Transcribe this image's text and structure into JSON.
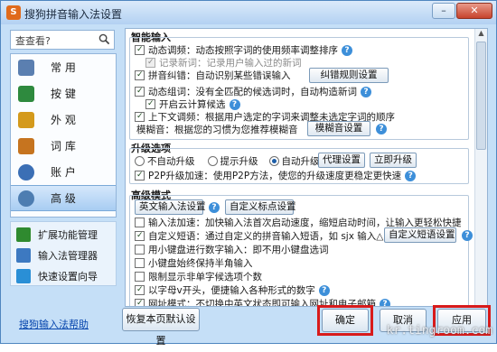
{
  "window": {
    "title": "搜狗拼音输入法设置"
  },
  "search": {
    "placeholder": "查查看?"
  },
  "nav": [
    {
      "label": "常 用",
      "icon": "wrench-icon",
      "color": "#5b7fb0"
    },
    {
      "label": "按 键",
      "icon": "keyboard-icon",
      "color": "#2e8a3e"
    },
    {
      "label": "外 观",
      "icon": "brush-icon",
      "color": "#d49a1c"
    },
    {
      "label": "词 库",
      "icon": "book-icon",
      "color": "#c6741f"
    },
    {
      "label": "账 户",
      "icon": "user-icon",
      "color": "#3b6fb5"
    },
    {
      "label": "高 级",
      "icon": "gear-icon",
      "color": "#4d7db1",
      "active": true
    }
  ],
  "tools": [
    {
      "label": "扩展功能管理",
      "icon": "puzzle-icon",
      "color": "#2f8a2f"
    },
    {
      "label": "输入法管理器",
      "icon": "grid-icon",
      "color": "#3d79c1"
    },
    {
      "label": "快速设置向导",
      "icon": "wand-icon",
      "color": "#2a8fd6"
    }
  ],
  "help_link": "搜狗输入法帮助",
  "sections": {
    "smart": {
      "title": "智能输入",
      "dynamic_freq": "动态调频：动态按照字词的使用频率调整排序",
      "remember_new": "记录新词：记录用户输入过的新词",
      "pinyin_correct": "拼音纠错：自动识别某些错误输入",
      "correct_rule_btn": "纠错规则设置",
      "dynamic_compose": "动态组词：没有全匹配的候选词时，自动构造新词",
      "cloud_candidate": "开启云计算候选",
      "context_adjust": "上下文调频：根据用户选定的字词来调整未选定字词的顺序",
      "fuzzy": "模糊音：根据您的习惯为您推荐模糊音",
      "fuzzy_btn": "模糊音设置"
    },
    "upgrade": {
      "title": "升级选项",
      "options": [
        "不自动升级",
        "提示升级",
        "自动升级"
      ],
      "selected": "自动升级",
      "proxy_btn": "代理设置",
      "upgrade_now_btn": "立即升级",
      "p2p": "P2P升级加速：使用P2P方法，使您的升级速度更稳定更快速"
    },
    "advanced": {
      "title": "高级模式",
      "english_btn": "英文输入法设置",
      "custom_punct_btn": "自定义标点设置",
      "input_accel": "输入法加速：加快输入法首次启动速度，缩短启动时间，让输入更轻松快捷",
      "custom_phrase": "自定义短语：通过自定义的拼音输入短语，如 sjx 输入△",
      "custom_phrase_btn": "自定义短语设置",
      "numpad": "用小键盘进行数字输入：即不用小键盘选词",
      "numpad_half": "小键盘始终保持半角输入",
      "limit_candidates": "限制显示非单字候选项个数",
      "v_mode": "以字母v开头，便捷输入各种形式的数字",
      "url_mode": "网址模式：不切换中英文状态即可输入网址和电子邮箱"
    }
  },
  "footer": {
    "restore": "恢复本页默认设置",
    "ok": "确定",
    "cancel": "取消",
    "apply": "应用"
  },
  "watermark": "kr.tingroom.com"
}
